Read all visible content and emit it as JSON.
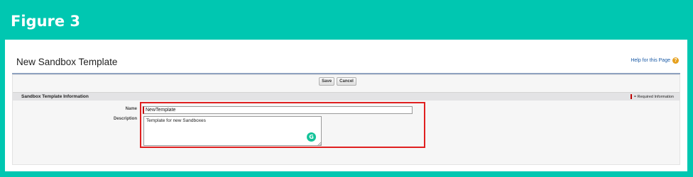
{
  "figure": {
    "label": "Figure 3"
  },
  "page": {
    "title": "New Sandbox Template",
    "help_link": "Help for this Page",
    "help_icon": "help-icon"
  },
  "toolbar": {
    "save_label": "Save",
    "cancel_label": "Cancel"
  },
  "section": {
    "title": "Sandbox Template Information",
    "required_legend": "= Required Information"
  },
  "form": {
    "name_label": "Name",
    "name_value": "NewTemplate",
    "description_label": "Description",
    "description_value": "Template for new Sandboxes"
  },
  "colors": {
    "frame": "#00c7b1",
    "highlight": "#e02020",
    "required": "#c00000",
    "grammarly": "#15c39a"
  }
}
